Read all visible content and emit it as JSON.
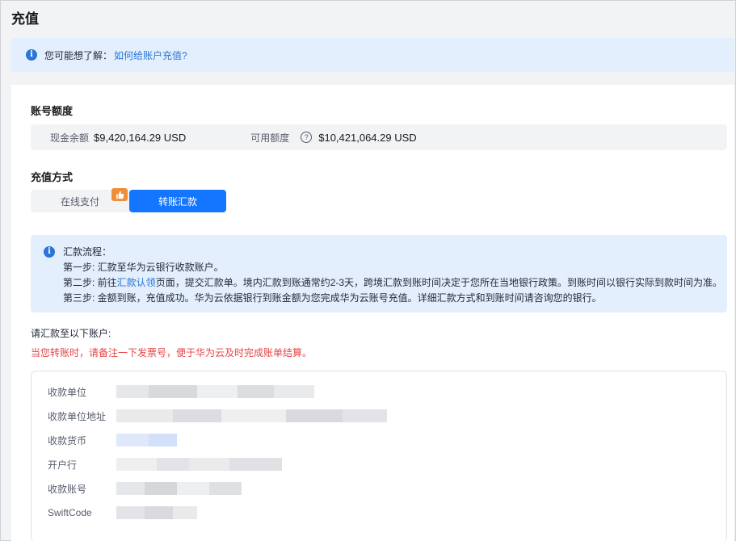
{
  "page": {
    "title": "充值"
  },
  "tip": {
    "text": "您可能想了解：",
    "link": "如何给账户充值?"
  },
  "quota": {
    "title": "账号额度",
    "cash_label": "现金余额",
    "cash_value": "$9,420,164.29 USD",
    "available_label": "可用额度",
    "available_value": "$10,421,064.29 USD"
  },
  "method": {
    "title": "充值方式",
    "tabs": [
      {
        "label": "在线支付",
        "selected": false
      },
      {
        "label": "转账汇款",
        "selected": true
      }
    ]
  },
  "flow": {
    "heading": "汇款流程：",
    "step1": "第一步: 汇款至华为云银行收款账户。",
    "step2_prefix": "第二步: 前往",
    "step2_link": "汇款认领",
    "step2_suffix": "页面，提交汇款单。境内汇款到账通常约2-3天，跨境汇款到账时间决定于您所在当地银行政策。到账时间以银行实际到款时间为准。",
    "step3": "第三步: 金额到账，充值成功。华为云依据银行到账金额为您完成华为云账号充值。详细汇款方式和到账时间请咨询您的银行。"
  },
  "account": {
    "intro": "请汇款至以下账户:",
    "warning": "当您转账时，请备注一下发票号，便于华为云及时完成账单结算。",
    "rows": [
      {
        "label": "收款单位"
      },
      {
        "label": "收款单位地址"
      },
      {
        "label": "收款货币"
      },
      {
        "label": "开户行"
      },
      {
        "label": "收款账号"
      },
      {
        "label": "SwiftCode"
      }
    ]
  },
  "colors": {
    "primary": "#1476ff",
    "link": "#2a75d8",
    "warning": "#e54545",
    "info_bg": "#e3effc",
    "badge": "#f08d38"
  },
  "icons": [
    "info-icon",
    "help-icon",
    "thumbs-up-icon"
  ]
}
